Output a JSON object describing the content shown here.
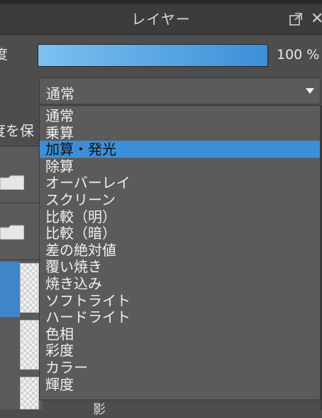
{
  "panel": {
    "title": "レイヤー"
  },
  "opacity": {
    "label": "度",
    "value_text": "100 %",
    "fill_fraction": 1.0
  },
  "blend_mode": {
    "selected": "通常",
    "menu_items": [
      "通常",
      "乗算",
      "加算・発光",
      "除算",
      "オーバーレイ",
      "スクリーン",
      "比較（明）",
      "比較（暗）",
      "差の絶対値",
      "覆い焼き",
      "焼き込み",
      "ソフトライト",
      "ハードライト",
      "色相",
      "彩度",
      "カラー",
      "輝度"
    ],
    "highlighted_index": 2
  },
  "protect": {
    "label": "度を保"
  },
  "bottom_text": "影",
  "colors": {
    "accent": "#3b8fd8",
    "menu_bg": "#5b5b5b",
    "panel_bg": "#4d4d4d"
  }
}
